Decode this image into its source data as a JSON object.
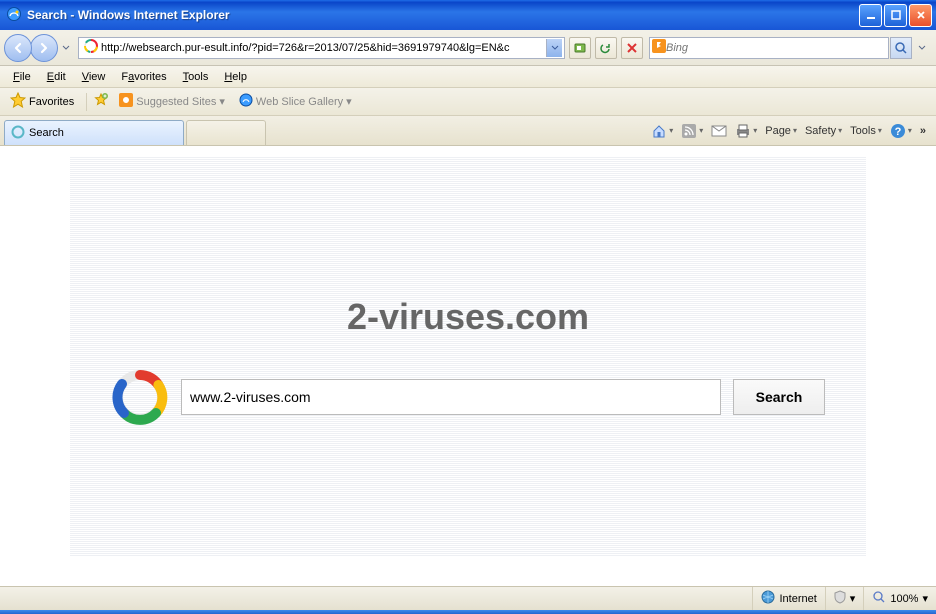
{
  "window": {
    "title": "Search - Windows Internet Explorer"
  },
  "nav": {
    "url": "http://websearch.pur-esult.info/?pid=726&r=2013/07/25&hid=3691979740&lg=EN&c",
    "search_provider": "Bing"
  },
  "menu": {
    "file": "File",
    "edit": "Edit",
    "view": "View",
    "favorites": "Favorites",
    "tools": "Tools",
    "help": "Help"
  },
  "favbar": {
    "favorites_label": "Favorites",
    "suggested": "Suggested Sites",
    "webslice": "Web Slice Gallery"
  },
  "tab": {
    "label": "Search"
  },
  "toolbar": {
    "page": "Page",
    "safety": "Safety",
    "tools": "Tools"
  },
  "page": {
    "brand": "2-viruses.com",
    "search_value": "www.2-viruses.com",
    "search_button": "Search"
  },
  "status": {
    "zone": "Internet",
    "zoom": "100%"
  }
}
